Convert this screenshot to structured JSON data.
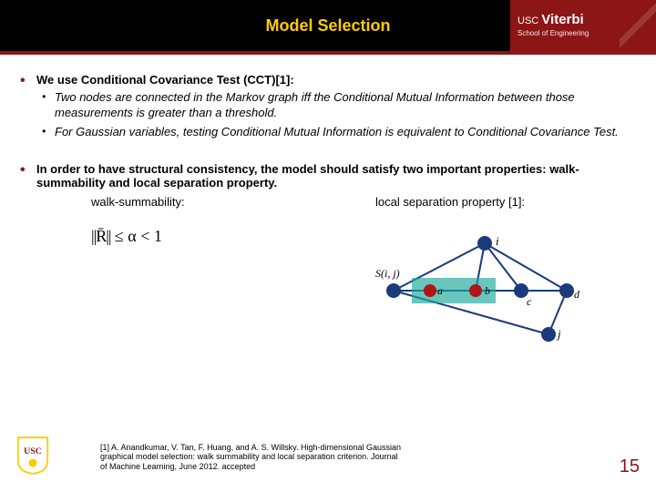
{
  "header": {
    "title": "Model Selection",
    "logo_line1_a": "USC",
    "logo_line1_b": "Viterbi",
    "logo_line2": "School of Engineering"
  },
  "bullets": {
    "b1": "We use ",
    "b1_strong": "Conditional Covariance Test (CCT)[1]:",
    "b1_sub1": "Two nodes are connected in the Markov graph iff the Conditional Mutual Information between those measurements is greater than a threshold.",
    "b1_sub2": "For Gaussian variables, testing Conditional Mutual Information is equivalent to Conditional Covariance Test.",
    "b2": "In order to have structural consistency, the model should satisfy two important properties: walk-summability and local separation property."
  },
  "cols": {
    "c1_label": "walk-summability:",
    "c2_label": "local separation property [1]:"
  },
  "formula": {
    "part1": "||R̄||",
    "part2": " ≤ α < 1"
  },
  "diagram_labels": {
    "i": "i",
    "a": "a",
    "b": "b",
    "c": "c",
    "d": "d",
    "j": "j",
    "set": "S(i, j)"
  },
  "reference": "[1] A. Anandkumar, V. Tan, F. Huang, and A. S. Willsky. High-dimensional Gaussian graphical model selection: walk summability and local separation criterion. Journal of Machine Learning, June 2012. accepted",
  "page_number": "15"
}
